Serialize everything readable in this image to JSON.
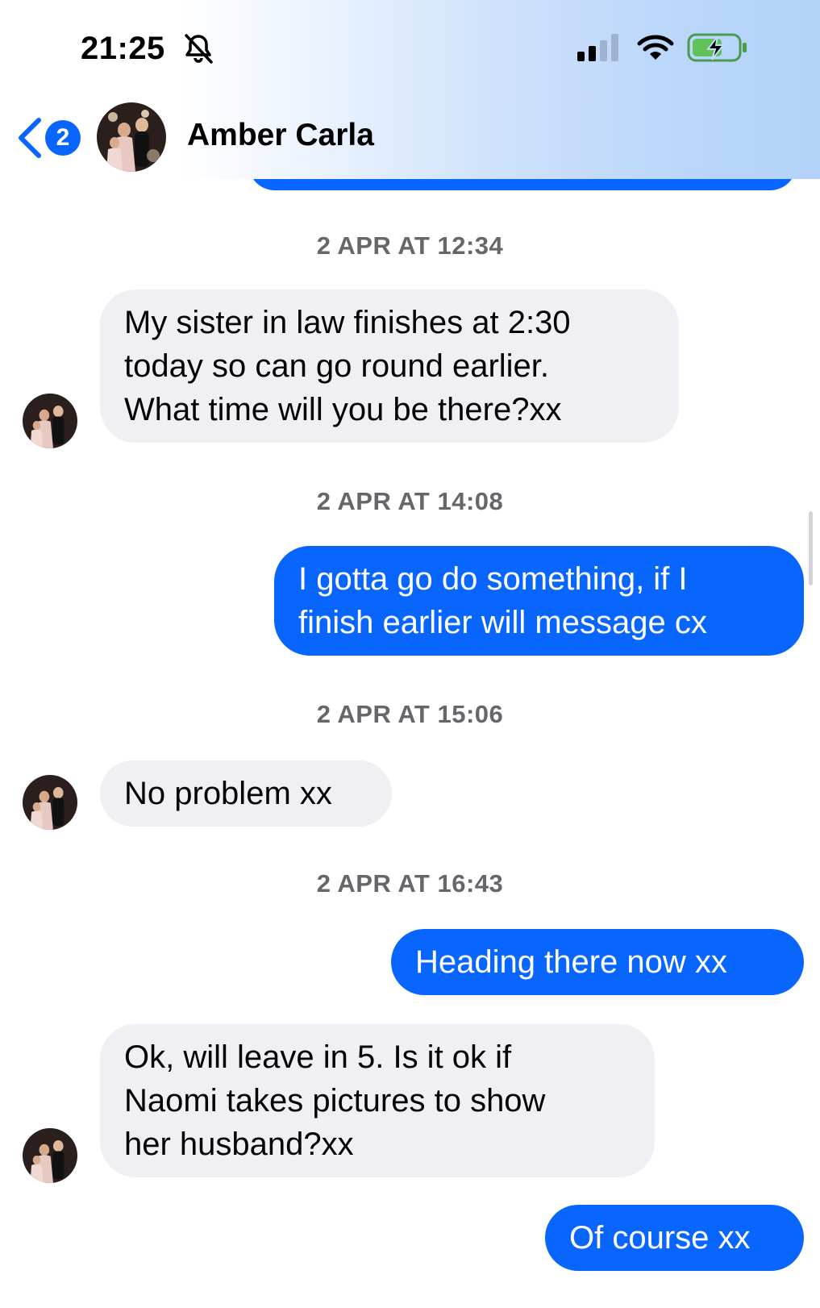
{
  "status_bar": {
    "time": "21:25"
  },
  "header": {
    "back_badge_count": "2",
    "contact_name": "Amber Carla"
  },
  "colors": {
    "accent": "#0866ff",
    "incoming_bubble": "#f0f0f4",
    "timestamp": "#65676b"
  },
  "messages": {
    "ts1": "2 APR AT 12:34",
    "m1": {
      "line1": "My sister in law finishes at 2:30",
      "line2": "today so can go round earlier.",
      "line3": "What time will you be there?xx"
    },
    "ts2": "2 APR AT 14:08",
    "m2": {
      "line1": "I gotta go do something, if I",
      "line2": "finish earlier will message cx"
    },
    "ts3": "2 APR AT 15:06",
    "m3": "No problem xx",
    "ts4": "2 APR AT 16:43",
    "m4": "Heading there now xx",
    "m5": {
      "line1": "Ok, will leave in 5. Is it ok if",
      "line2": "Naomi takes pictures to show",
      "line3": "her husband?xx"
    },
    "m6": "Of course xx"
  }
}
